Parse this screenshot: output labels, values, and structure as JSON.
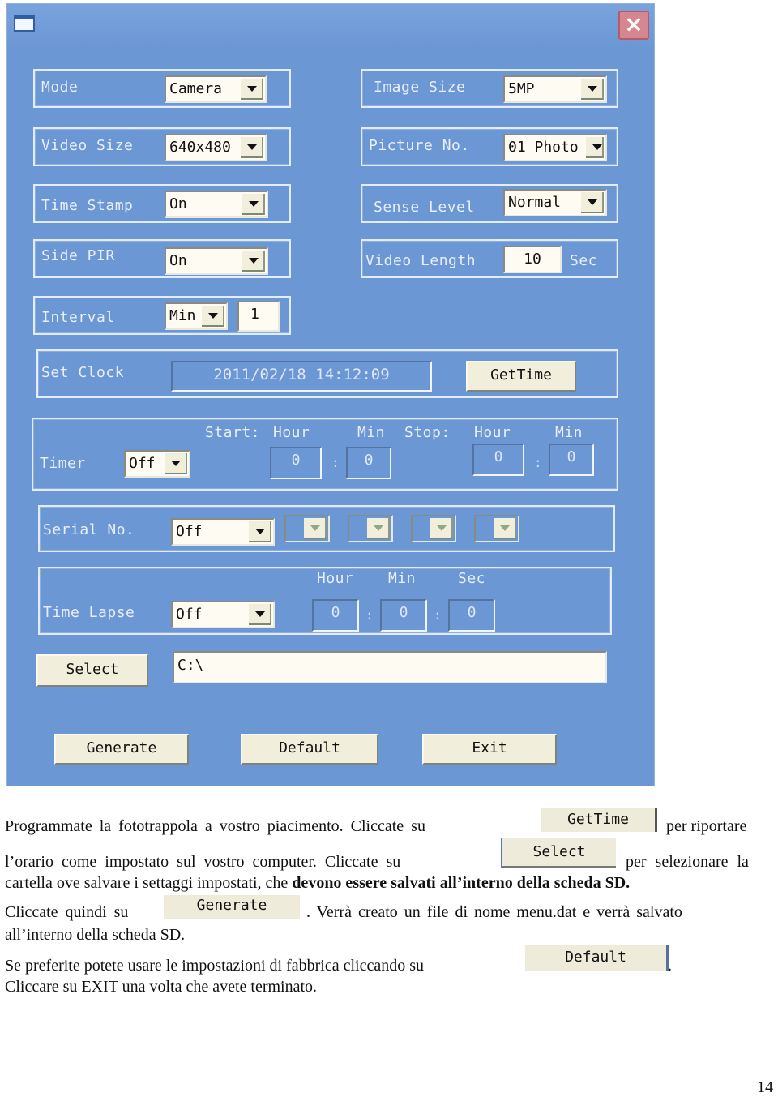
{
  "window": {
    "close_icon": "close-x-icon",
    "app_icon": "window-icon"
  },
  "settings": {
    "mode": {
      "label": "Mode",
      "value": "Camera"
    },
    "image_size": {
      "label": "Image Size",
      "value": "5MP"
    },
    "video_size": {
      "label": "Video Size",
      "value": "640x480"
    },
    "picture_no": {
      "label": "Picture No.",
      "value": "01 Photo"
    },
    "time_stamp": {
      "label": "Time Stamp",
      "value": "On"
    },
    "sense_level": {
      "label": "Sense Level",
      "value": "Normal"
    },
    "side_pir": {
      "label": "Side PIR",
      "value": "On"
    },
    "video_length": {
      "label": "Video Length",
      "value": "10",
      "unit": "Sec"
    },
    "interval": {
      "label": "Interval",
      "unit_value": "Min",
      "value": "1"
    }
  },
  "set_clock": {
    "label": "Set Clock",
    "value": "2011/02/18 14:12:09",
    "button": "GetTime"
  },
  "timer": {
    "label": "Timer",
    "value": "Off",
    "start_label": "Start:",
    "stop_label": "Stop:",
    "hour_label": "Hour",
    "min_label": "Min",
    "start_hour": "0",
    "start_min": "0",
    "stop_hour": "0",
    "stop_min": "0",
    "sep": ":"
  },
  "serial_no": {
    "label": "Serial No.",
    "value": "Off"
  },
  "time_lapse": {
    "label": "Time Lapse",
    "value": "Off",
    "hour_label": "Hour",
    "min_label": "Min",
    "sec_label": "Sec",
    "hour": "0",
    "min": "0",
    "sec": "0",
    "sep": ":"
  },
  "path": {
    "button": "Select",
    "value": "C:\\"
  },
  "actions": {
    "generate": "Generate",
    "default": "Default",
    "exit": "Exit"
  },
  "doc": {
    "p1a": "Programmate la fototrappola a vostro piacimento. Cliccate su",
    "p1b": "per riportare",
    "p2a": "l’orario come impostato sul vostro computer. Cliccate su",
    "p2b": "per selezionare la",
    "p3a": "cartella ove salvare i settaggi impostati, che ",
    "p3b": "devono essere salvati all’interno della scheda SD.",
    "p4a": "Cliccate quindi su",
    "p4b": ". Verrà creato un file di nome menu.dat e verrà salvato",
    "p5": "all’interno della scheda SD.",
    "p6a": "Se preferite potete usare le impostazioni di fabbrica cliccando su",
    "p6b": ".",
    "p7": "Cliccare su EXIT una volta che avete terminato.",
    "btn_gettime": "GetTime",
    "btn_select": "Select",
    "btn_generate": "Generate",
    "btn_default": "Default"
  },
  "page_number": "14"
}
